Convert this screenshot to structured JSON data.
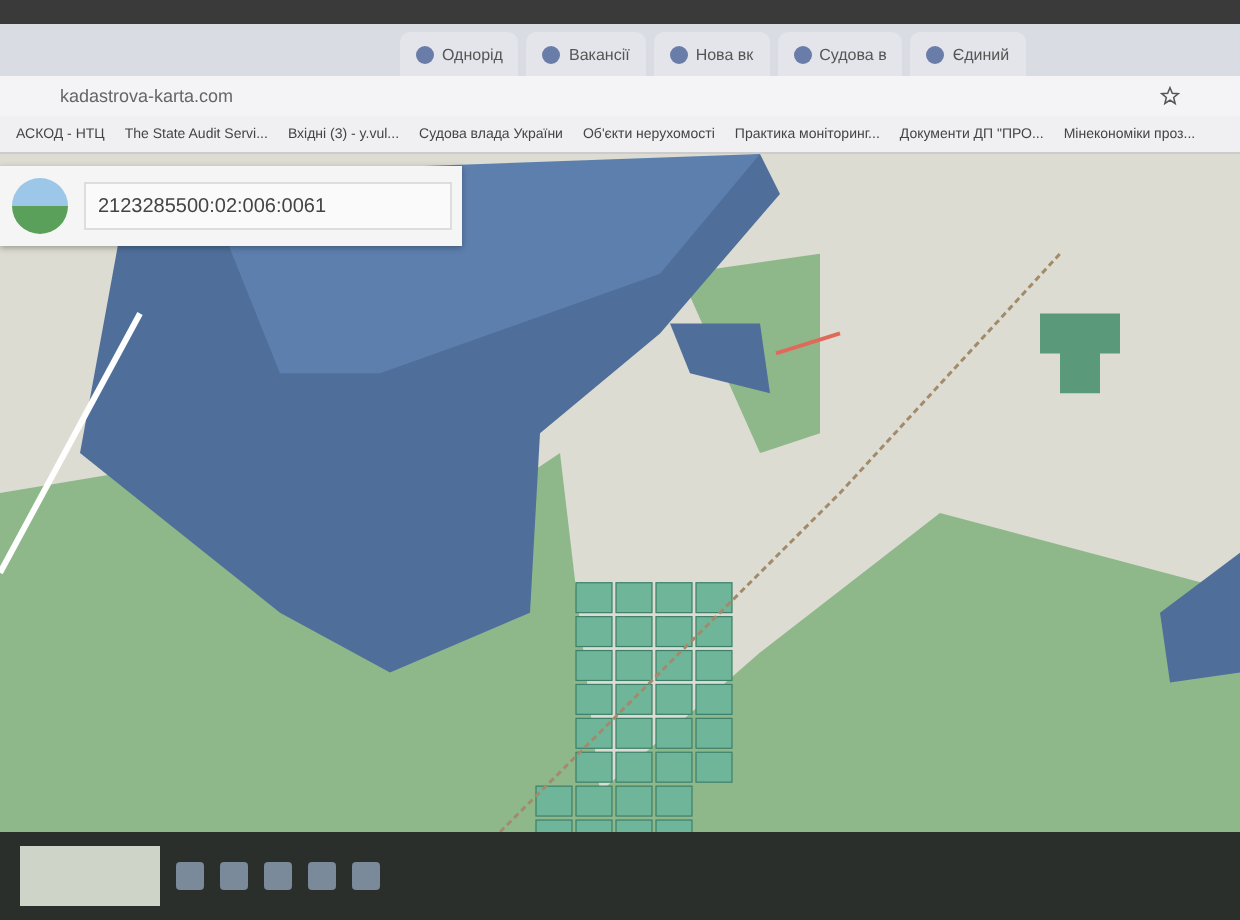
{
  "tabs": [
    {
      "label": "Однорід",
      "selected": false
    },
    {
      "label": "Вакансії",
      "selected": false
    },
    {
      "label": "Нова вк",
      "selected": false
    },
    {
      "label": "Судова в",
      "selected": false
    },
    {
      "label": "Єдиний",
      "selected": false
    }
  ],
  "address_bar": {
    "url": "kadastrova-karta.com"
  },
  "bookmarks": [
    "АСКОД - НТЦ",
    "The State Audit Servi...",
    "Вхідні (3) - y.vul...",
    "Судова влада України",
    "Об'єкти нерухомості",
    "Практика моніторинг...",
    "Документи ДП \"ПРО...",
    "Мінекономіки проз..."
  ],
  "search": {
    "value": "2123285500:02:006:0061"
  }
}
